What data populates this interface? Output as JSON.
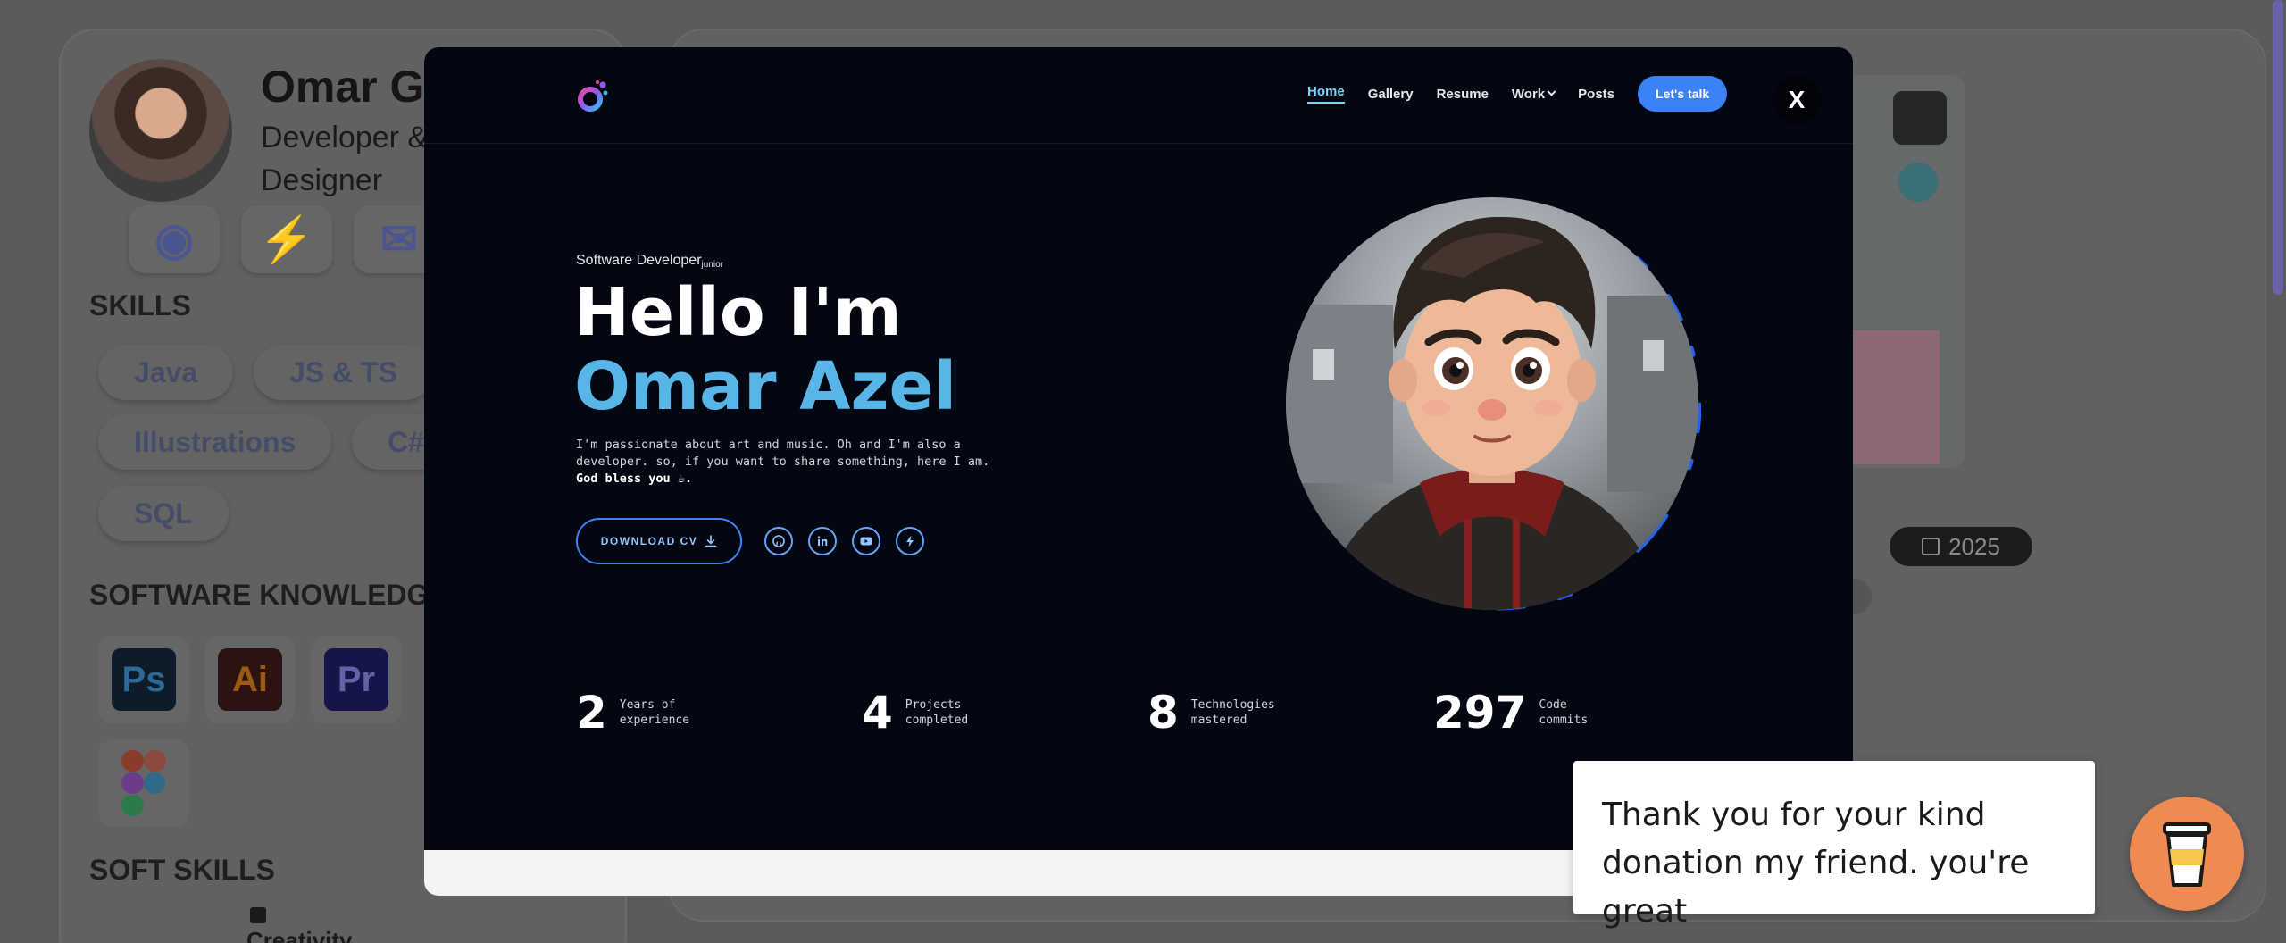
{
  "background": {
    "profile_name": "Omar Gu",
    "profile_role": "Developer & Designer",
    "skills_heading": "SKILLS",
    "skills": [
      "Java",
      "JS & TS",
      "Illustrations",
      "C#",
      "SQL"
    ],
    "software_heading": "SOFTWARE KNOWLEDG",
    "software": [
      {
        "label": "Ps",
        "bg": "#001e36",
        "fg": "#31a8ff"
      },
      {
        "label": "Ai",
        "bg": "#330000",
        "fg": "#ff9a00"
      },
      {
        "label": "Pr",
        "bg": "#00005b",
        "fg": "#9999ff"
      }
    ],
    "soft_skills_heading": "SOFT SKILLS",
    "soft_skill_first": "Creativity",
    "year_badge": "2025"
  },
  "modal": {
    "nav": {
      "items": [
        {
          "label": "Home",
          "active": true
        },
        {
          "label": "Gallery",
          "active": false
        },
        {
          "label": "Resume",
          "active": false
        },
        {
          "label": "Work",
          "active": false
        },
        {
          "label": "Posts",
          "active": false
        }
      ],
      "cta": "Let's talk"
    },
    "close_label": "X",
    "hero": {
      "eyebrow": "Software Developer",
      "eyebrow_sub": "junior",
      "greeting": "Hello I'm",
      "name": "Omar Azel",
      "bio_line1": "I'm passionate about art and music. Oh and I'm also a",
      "bio_line2": "developer. so, if you want to share something, here I am.",
      "bio_bold": "God bless you ☕.",
      "download_label": "DOWNLOAD CV"
    },
    "socials": [
      "github-icon",
      "linkedin-icon",
      "youtube-icon",
      "zap-icon"
    ],
    "stats": [
      {
        "value": "2",
        "label1": "Years of",
        "label2": "experience"
      },
      {
        "value": "4",
        "label1": "Projects",
        "label2": "completed"
      },
      {
        "value": "8",
        "label1": "Technologies",
        "label2": "mastered"
      },
      {
        "value": "297",
        "label1": "Code",
        "label2": "commits"
      }
    ],
    "accent": "#57b5e7",
    "cta_color": "#3b82f6"
  },
  "toast": {
    "message": "Thank you for your kind donation my friend. you're great"
  }
}
